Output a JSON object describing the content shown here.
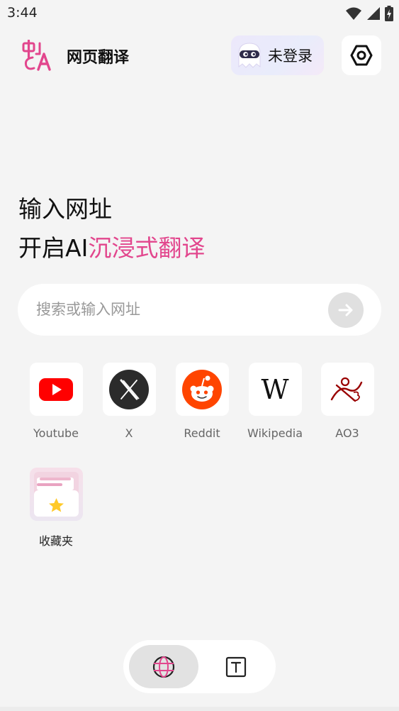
{
  "status_bar": {
    "time": "3:44"
  },
  "header": {
    "app_title": "网页翻译",
    "login_label": "未登录"
  },
  "hero": {
    "line1": "输入网址",
    "line2_prefix": "开启AI",
    "line2_accent": "沉浸式翻译"
  },
  "search": {
    "placeholder": "搜索或输入网址",
    "value": ""
  },
  "shortcuts": [
    {
      "label": "Youtube",
      "icon": "youtube-icon"
    },
    {
      "label": "X",
      "icon": "x-icon"
    },
    {
      "label": "Reddit",
      "icon": "reddit-icon"
    },
    {
      "label": "Wikipedia",
      "icon": "wikipedia-icon"
    },
    {
      "label": "AO3",
      "icon": "ao3-icon"
    }
  ],
  "favorites": {
    "label": "收藏夹",
    "icon": "bookmark-folder-icon"
  },
  "colors": {
    "accent": "#e2468d",
    "background": "#f4f4f4",
    "tile": "#ffffff",
    "youtube_red": "#ff0000",
    "reddit_orange": "#ff4500",
    "ao3_red": "#990000"
  },
  "bottom_nav": {
    "items": [
      {
        "icon": "globe-icon",
        "active": true
      },
      {
        "icon": "text-icon",
        "active": false
      }
    ]
  }
}
